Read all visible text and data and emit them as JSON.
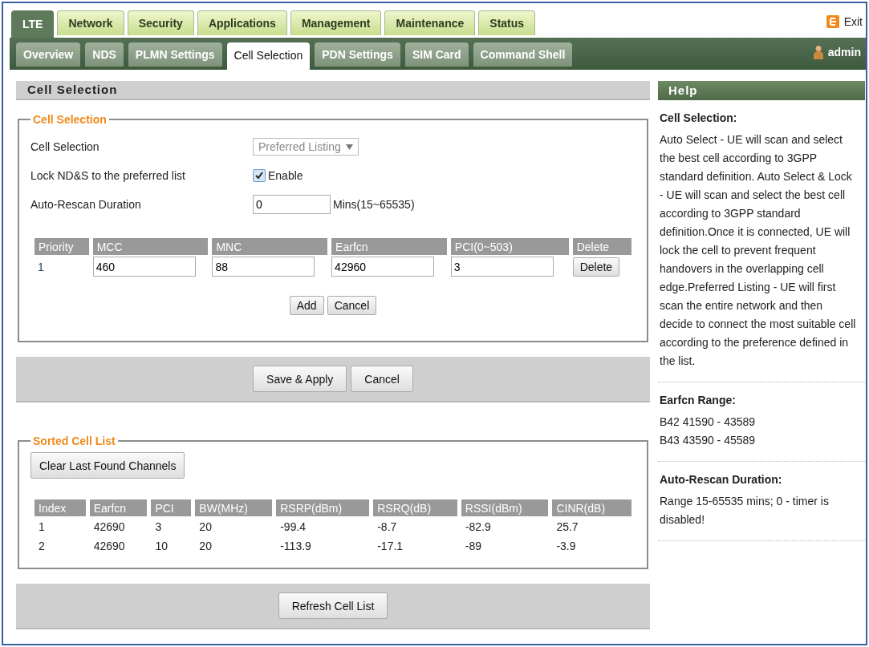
{
  "top_tabs": [
    {
      "label": "LTE",
      "selected": true
    },
    {
      "label": "Network",
      "selected": false
    },
    {
      "label": "Security",
      "selected": false
    },
    {
      "label": "Applications",
      "selected": false
    },
    {
      "label": "Management",
      "selected": false
    },
    {
      "label": "Maintenance",
      "selected": false
    },
    {
      "label": "Status",
      "selected": false
    }
  ],
  "exit": {
    "label": "Exit"
  },
  "sub_tabs": [
    {
      "label": "Overview",
      "selected": false
    },
    {
      "label": "NDS",
      "selected": false
    },
    {
      "label": "PLMN Settings",
      "selected": false
    },
    {
      "label": "Cell Selection",
      "selected": true
    },
    {
      "label": "PDN Settings",
      "selected": false
    },
    {
      "label": "SIM Card",
      "selected": false
    },
    {
      "label": "Command Shell",
      "selected": false
    }
  ],
  "user": {
    "name": "admin"
  },
  "section_title": "Cell Selection",
  "cell_selection": {
    "legend": "Cell Selection",
    "fields": [
      {
        "kind": "select",
        "label": "Cell Selection",
        "value": "Preferred Listing",
        "disabled": true
      },
      {
        "kind": "checkbox",
        "label": "Lock ND&S to the preferred list",
        "option": "Enable",
        "checked": true
      },
      {
        "kind": "text",
        "label": "Auto-Rescan Duration",
        "value": "0",
        "unit": "Mins(15~65535)"
      }
    ],
    "columns": [
      "Priority",
      "MCC",
      "MNC",
      "Earfcn",
      "PCI(0~503)",
      "Delete"
    ],
    "rows": [
      {
        "priority": "1",
        "mcc": "460",
        "mnc": "88",
        "earfcn": "42960",
        "pci": "3",
        "action": "Delete"
      }
    ],
    "buttons": [
      "Add",
      "Cancel"
    ]
  },
  "action_buttons": [
    "Save & Apply",
    "Cancel"
  ],
  "sorted_cell_list": {
    "legend": "Sorted Cell List",
    "clear_button": "Clear Last Found Channels",
    "columns": [
      "Index",
      "Earfcn",
      "PCI",
      "BW(MHz)",
      "RSRP(dBm)",
      "RSRQ(dB)",
      "RSSI(dBm)",
      "CINR(dB)"
    ],
    "rows": [
      [
        "1",
        "42690",
        "3",
        "20",
        "-99.4",
        "-8.7",
        "-82.9",
        "25.7"
      ],
      [
        "2",
        "42690",
        "10",
        "20",
        "-113.9",
        "-17.1",
        "-89",
        "-3.9"
      ]
    ]
  },
  "refresh_button": "Refresh Cell List",
  "help": {
    "title": "Help",
    "sections": [
      {
        "heading": "Cell Selection:",
        "lines": [
          "Auto Select - UE will scan and select the best cell according to 3GPP standard definition. Auto Select & Lock - UE will scan and select the best cell according to 3GPP standard definition.Once it is connected, UE will lock the cell to prevent frequent handovers in the overlapping cell edge.Preferred Listing - UE will first scan the entire network and then decide to connect the most suitable cell according to the preference defined in the list."
        ]
      },
      {
        "heading": "Earfcn Range:",
        "lines": [
          "B42 41590 - 43589",
          "B43 43590 - 45589"
        ]
      },
      {
        "heading": "Auto-Rescan Duration:",
        "lines": [
          "Range 15-65535 mins; 0 - timer is disabled!"
        ]
      }
    ]
  }
}
